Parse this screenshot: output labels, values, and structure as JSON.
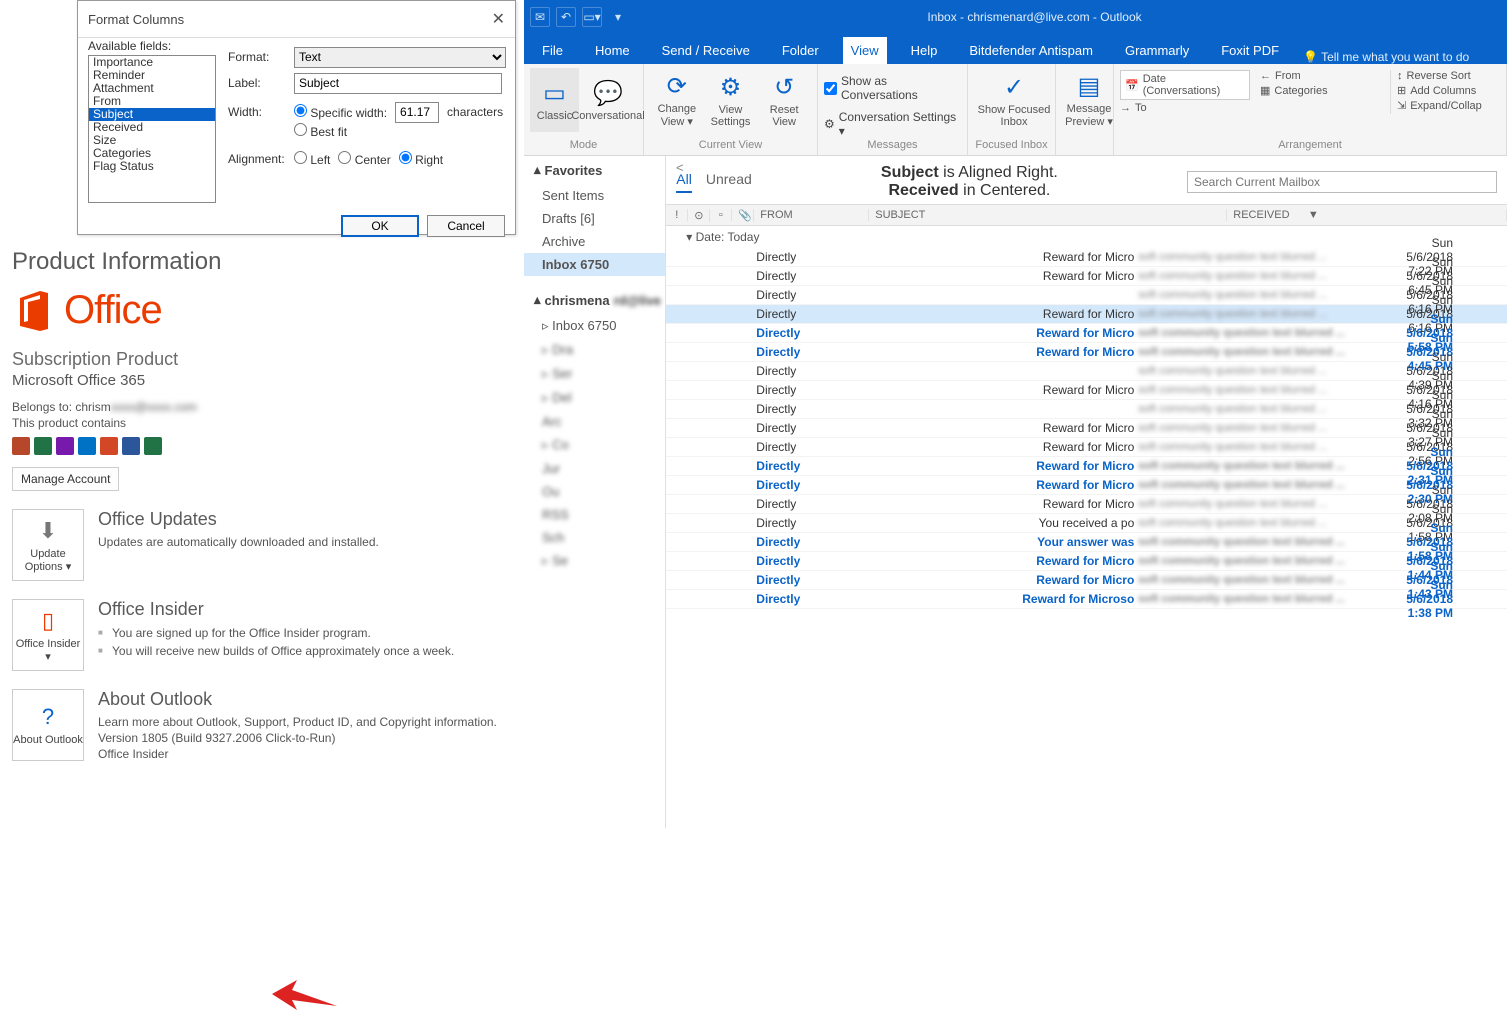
{
  "dialog": {
    "title": "Format Columns",
    "available_label": "Available fields:",
    "fields": [
      "Importance",
      "Reminder",
      "Attachment",
      "From",
      "Subject",
      "Received",
      "Size",
      "Categories",
      "Flag Status"
    ],
    "selected_field_index": 4,
    "format_label": "Format:",
    "format_value": "Text",
    "label_label": "Label:",
    "label_value": "Subject",
    "width_label": "Width:",
    "specific_width_label": "Specific width:",
    "specific_width_value": "61.17",
    "characters_label": "characters",
    "best_fit_label": "Best fit",
    "alignment_label": "Alignment:",
    "align_left": "Left",
    "align_center": "Center",
    "align_right": "Right",
    "ok": "OK",
    "cancel": "Cancel"
  },
  "product": {
    "heading": "Product Information",
    "office_word": "Office",
    "sub_heading": "Subscription Product",
    "edition": "Microsoft Office 365",
    "belongs": "Belongs to: chrism",
    "contains": "This product contains",
    "manage": "Manage Account",
    "updates_h": "Office Updates",
    "updates_t": "Updates are automatically downloaded and installed.",
    "update_btn": "Update Options ▾",
    "insider_h": "Office Insider",
    "insider_b1": "You are signed up for the Office Insider program.",
    "insider_b2": "You will receive new builds of Office approximately once a week.",
    "insider_btn": "Office Insider ▾",
    "about_h": "About Outlook",
    "about_t": "Learn more about Outlook, Support, Product ID, and Copyright information.",
    "about_v": "Version 1805 (Build 9327.2006 Click-to-Run)",
    "about_ch": "Office Insider",
    "about_btn": "About Outlook",
    "app_colors": [
      "#b7472a",
      "#217346",
      "#7719aa",
      "#0072c6",
      "#d24726",
      "#2b579a",
      "#217346"
    ]
  },
  "outlook": {
    "window_title": "Inbox - chrismenard@live.com - Outlook",
    "tabs": [
      "File",
      "Home",
      "Send / Receive",
      "Folder",
      "View",
      "Help",
      "Bitdefender Antispam",
      "Grammarly",
      "Foxit PDF"
    ],
    "active_tab": 4,
    "tell_me": "Tell me what you want to do",
    "ribbon": {
      "mode": {
        "classic": "Classic",
        "conv": "Conversational",
        "caption": "Mode"
      },
      "current_view": {
        "change": "Change View ▾",
        "settings": "View Settings",
        "reset": "Reset View",
        "caption": "Current View"
      },
      "messages": {
        "show_conv": "Show as Conversations",
        "conv_set": "Conversation Settings ▾",
        "focused": "Show Focused Inbox",
        "caption": "Messages",
        "focused_caption": "Focused Inbox"
      },
      "preview": {
        "label": "Message Preview ▾"
      },
      "arrange": {
        "date": "Date (Conversations)",
        "from": "From",
        "to": "To",
        "categories": "Categories",
        "reverse": "Reverse Sort",
        "add": "Add Columns",
        "expand": "Expand/Collap",
        "caption": "Arrangement"
      }
    },
    "nav": {
      "favorites": "Favorites",
      "fav_items": [
        {
          "label": "Sent Items"
        },
        {
          "label": "Drafts [6]"
        },
        {
          "label": "Archive"
        },
        {
          "label": "Inbox  6750",
          "selected": true
        }
      ],
      "account": "chrismena",
      "acct_items": [
        {
          "label": "Inbox  6750",
          "expand": true
        },
        {
          "label": "Dra",
          "blur": true,
          "expand": true
        },
        {
          "label": "Ser",
          "blur": true,
          "expand": true
        },
        {
          "label": "Del",
          "blur": true,
          "expand": true
        },
        {
          "label": "Arc",
          "blur": true
        },
        {
          "label": "Co",
          "blur": true,
          "expand": true
        },
        {
          "label": "Jur",
          "blur": true
        },
        {
          "label": "Ou",
          "blur": true
        },
        {
          "label": "RSS",
          "blur": true
        },
        {
          "label": "Sch",
          "blur": true
        },
        {
          "label": "Se",
          "blur": true,
          "expand": true
        }
      ]
    },
    "ml_tabs": {
      "all": "All",
      "unread": "Unread"
    },
    "annotation_line1a": "Subject",
    "annotation_line1b": " is Aligned Right.",
    "annotation_line2a": "Received",
    "annotation_line2b": " in Centered.",
    "search_placeholder": "Search Current Mailbox",
    "cols": {
      "from": "FROM",
      "subject": "SUBJECT",
      "received": "RECEIVED"
    },
    "date_group": "Date: Today",
    "rows": [
      {
        "from": "Directly",
        "subject": "Reward for Micro",
        "date": "Sun 5/6/2018 7:22 PM"
      },
      {
        "from": "Directly",
        "subject": "Reward for Micro",
        "date": "Sun 5/6/2018 6:45 PM"
      },
      {
        "from": "Directly",
        "subject": "",
        "date": "Sun 5/6/2018 6:16 PM"
      },
      {
        "from": "Directly",
        "subject": "Reward for Micro",
        "date": "Sun 5/6/2018 6:16 PM",
        "selected": true
      },
      {
        "from": "Directly",
        "subject": "Reward for Micro",
        "date": "Sun 5/6/2018 5:58 PM",
        "unread": true
      },
      {
        "from": "Directly",
        "subject": "Reward for Micro",
        "date": "Sun 5/6/2018 4:45 PM",
        "unread": true
      },
      {
        "from": "Directly",
        "subject": "",
        "date": "Sun 5/6/2018 4:39 PM"
      },
      {
        "from": "Directly",
        "subject": "Reward for Micro",
        "date": "Sun 5/6/2018 4:16 PM"
      },
      {
        "from": "Directly",
        "subject": "",
        "date": "Sun 5/6/2018 3:32 PM"
      },
      {
        "from": "Directly",
        "subject": "Reward for Micro",
        "date": "Sun 5/6/2018 3:27 PM"
      },
      {
        "from": "Directly",
        "subject": "Reward for Micro",
        "date": "Sun 5/6/2018 2:56 PM"
      },
      {
        "from": "Directly",
        "subject": "Reward for Micro",
        "date": "Sun 5/6/2018 2:31 PM",
        "unread": true
      },
      {
        "from": "Directly",
        "subject": "Reward for Micro",
        "date": "Sun 5/6/2018 2:30 PM",
        "unread": true
      },
      {
        "from": "Directly",
        "subject": "Reward for Micro",
        "date": "Sun 5/6/2018 2:08 PM"
      },
      {
        "from": "Directly",
        "subject": "You received a po",
        "date": "Sun 5/6/2018 1:58 PM"
      },
      {
        "from": "Directly",
        "subject": "Your answer was",
        "date": "Sun 5/6/2018 1:58 PM",
        "unread": true
      },
      {
        "from": "Directly",
        "subject": "Reward for Micro",
        "date": "Sun 5/6/2018 1:44 PM",
        "unread": true
      },
      {
        "from": "Directly",
        "subject": "Reward for Micro",
        "date": "Sun 5/6/2018 1:43 PM",
        "unread": true
      },
      {
        "from": "Directly",
        "subject": "Reward for Microso",
        "date": "Sun 5/6/2018 1:38 PM",
        "unread": true
      }
    ]
  }
}
